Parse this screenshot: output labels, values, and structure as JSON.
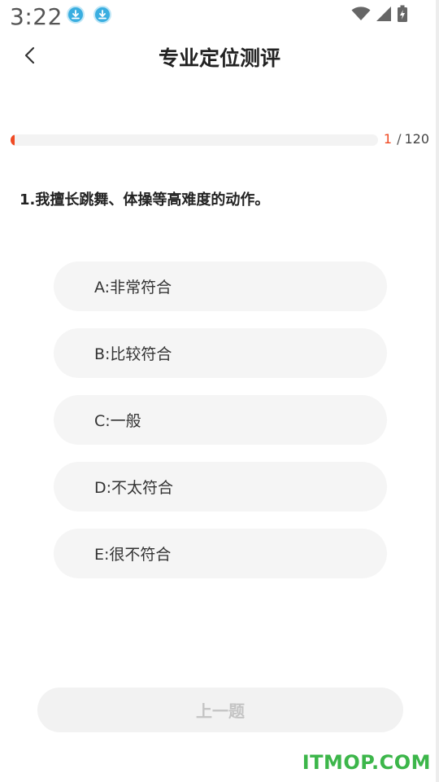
{
  "status_bar": {
    "time": "3:22",
    "icons": [
      "download-icon",
      "download-icon",
      "wifi-icon",
      "signal-icon",
      "battery-charging-icon"
    ]
  },
  "header": {
    "back_icon": "chevron-left-icon",
    "title": "专业定位测评"
  },
  "progress": {
    "current": "1",
    "separator": "/",
    "total": "120",
    "fraction": 0.0083,
    "fill_color": "#f04a23"
  },
  "question": {
    "text": "1.我擅长跳舞、体操等高难度的动作。"
  },
  "options": [
    {
      "label": "A:非常符合"
    },
    {
      "label": "B:比较符合"
    },
    {
      "label": "C:一般"
    },
    {
      "label": "D:不太符合"
    },
    {
      "label": "E:很不符合"
    }
  ],
  "footer": {
    "prev_label": "上一题"
  },
  "watermark": {
    "text": "ITMOP.COM"
  },
  "colors": {
    "accent": "#f04a23",
    "option_bg": "#f5f5f5",
    "watermark": "#3cb64a"
  }
}
